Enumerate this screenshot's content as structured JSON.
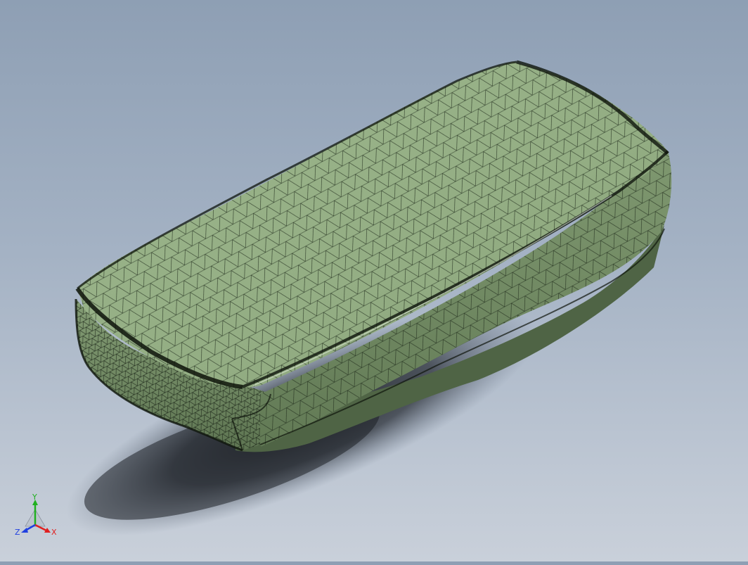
{
  "viewport": {
    "background_top": "#8e9fb4",
    "background_bottom": "#c9d0da",
    "model_fill": "#8fa97e",
    "mesh_color": "#1a2416"
  },
  "triad": {
    "x_label": "X",
    "y_label": "Y",
    "z_label": "Z",
    "x_color": "#e02020",
    "y_color": "#20b020",
    "z_color": "#2040e0"
  }
}
